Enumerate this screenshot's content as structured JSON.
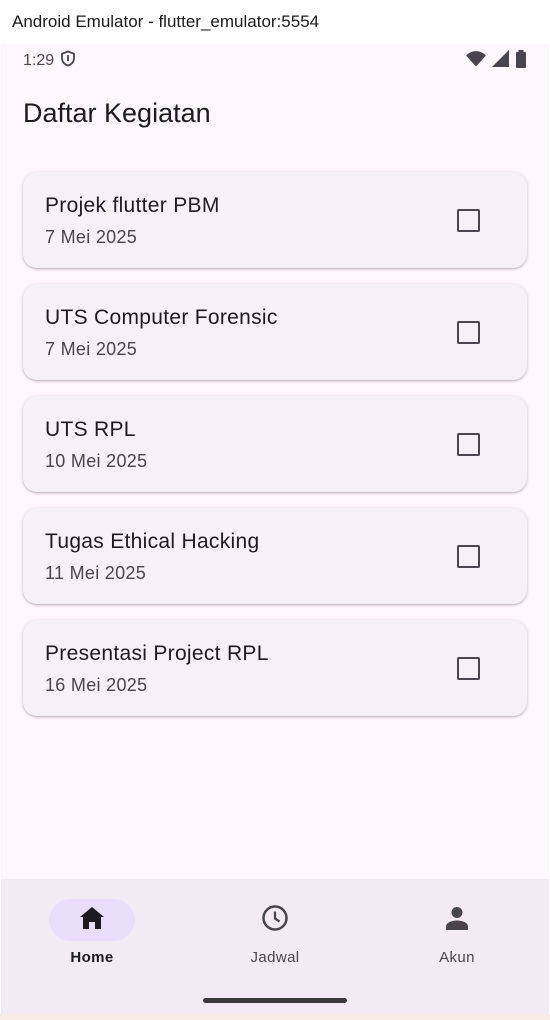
{
  "window": {
    "title": "Android Emulator - flutter_emulator:5554"
  },
  "status_bar": {
    "time": "1:29"
  },
  "app": {
    "title": "Daftar Kegiatan"
  },
  "tasks": [
    {
      "title": "Projek flutter PBM",
      "date": "7 Mei 2025",
      "done": false
    },
    {
      "title": "UTS Computer Forensic",
      "date": "7 Mei 2025",
      "done": false
    },
    {
      "title": "UTS RPL",
      "date": "10 Mei 2025",
      "done": false
    },
    {
      "title": "Tugas Ethical Hacking",
      "date": "11 Mei 2025",
      "done": false
    },
    {
      "title": "Presentasi Project RPL",
      "date": "16 Mei 2025",
      "done": false
    }
  ],
  "bottom_nav": {
    "items": [
      {
        "label": "Home",
        "icon": "home-icon",
        "active": true
      },
      {
        "label": "Jadwal",
        "icon": "clock-icon",
        "active": false
      },
      {
        "label": "Akun",
        "icon": "person-icon",
        "active": false
      }
    ]
  },
  "colors": {
    "background": "#fef7fd",
    "card": "#f6f1f6",
    "nav_background": "#f2ebf4",
    "active_pill": "#e9ddfb",
    "text_primary": "#1d1b20",
    "text_secondary": "#49454f"
  }
}
